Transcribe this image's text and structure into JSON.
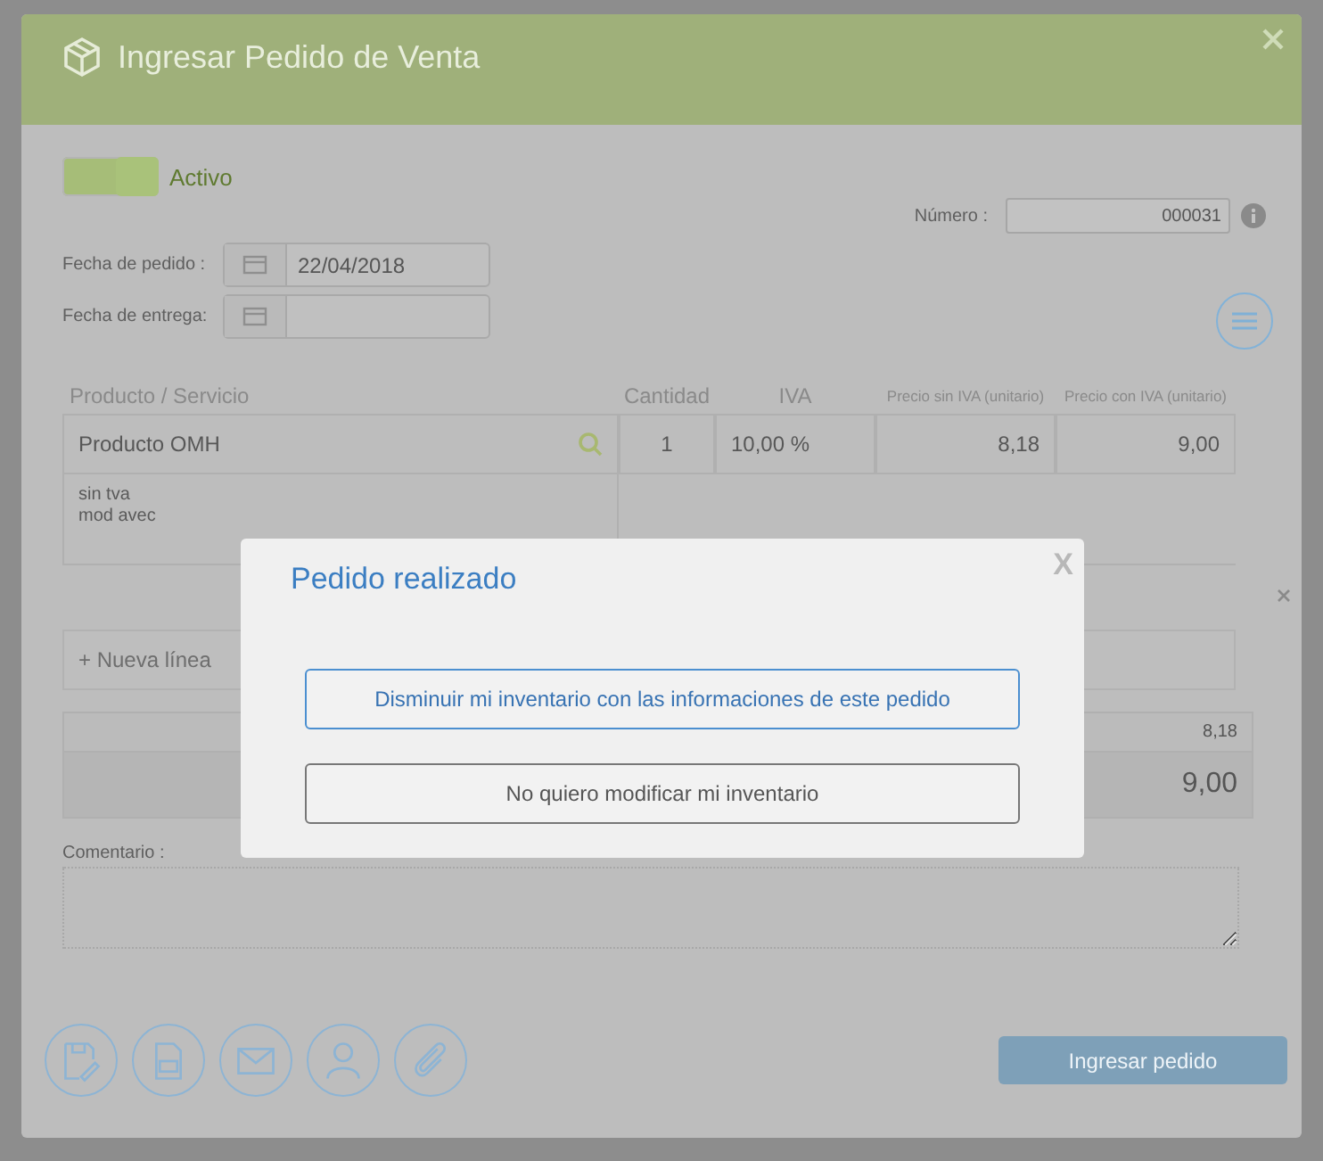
{
  "window": {
    "title": "Ingresar Pedido de Venta"
  },
  "status_toggle": {
    "label": "Activo",
    "on": true
  },
  "numero": {
    "label": "Número :",
    "value": "000031"
  },
  "fecha_pedido": {
    "label": "Fecha de pedido :",
    "value": "22/04/2018"
  },
  "fecha_entrega": {
    "label": "Fecha de entrega:"
  },
  "table": {
    "columns": [
      "Producto / Servicio",
      "Cantidad",
      "IVA",
      "Precio sin IVA (unitario)",
      "Precio con IVA (unitario)"
    ],
    "rows": [
      {
        "product": "Producto OMH",
        "quantity": "1",
        "iva": "10,00 %",
        "price_without_iva": "8,18",
        "price_with_iva": "9,00",
        "note": "sin tva\nmod avec"
      }
    ]
  },
  "new_line": {
    "placeholder": "+ Nueva línea"
  },
  "totals": [
    "8,18",
    "9,00"
  ],
  "comment": {
    "label": "Comentario :"
  },
  "submit_button": "Ingresar pedido",
  "modal": {
    "title": "Pedido realizado",
    "close": "X",
    "buttons": [
      {
        "label": "Disminuir mi inventario con las informaciones de este pedido",
        "primary": true
      },
      {
        "label": "No quiero modificar mi inventario",
        "primary": false
      }
    ]
  }
}
